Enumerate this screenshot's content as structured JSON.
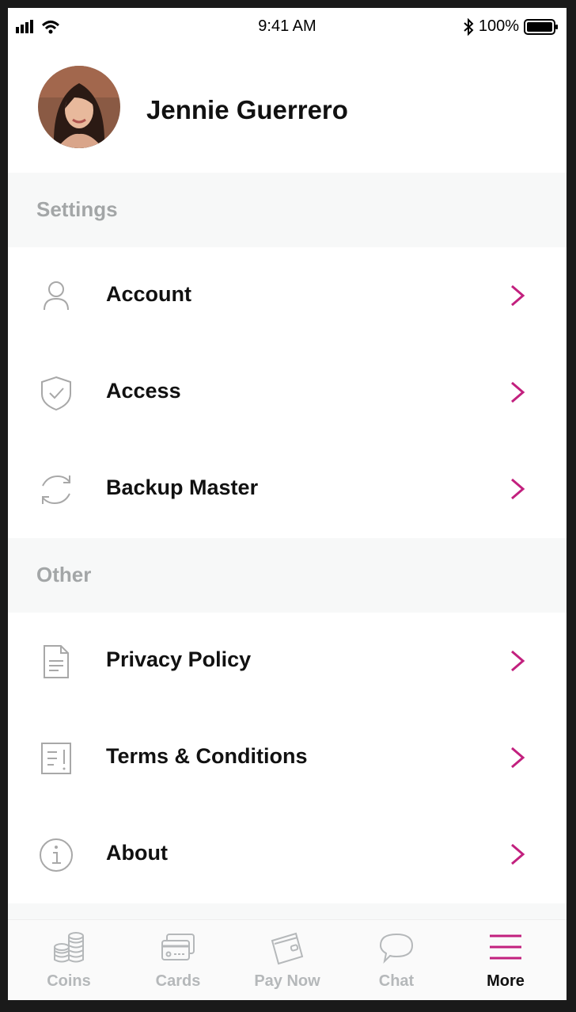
{
  "status_bar": {
    "time": "9:41 AM",
    "battery": "100%"
  },
  "profile": {
    "name": "Jennie Guerrero"
  },
  "sections": {
    "settings": {
      "title": "Settings",
      "items": [
        {
          "label": "Account",
          "icon": "user-icon"
        },
        {
          "label": "Access",
          "icon": "shield-check-icon"
        },
        {
          "label": "Backup Master",
          "icon": "sync-icon"
        }
      ]
    },
    "other": {
      "title": "Other",
      "items": [
        {
          "label": "Privacy Policy",
          "icon": "document-icon"
        },
        {
          "label": "Terms & Conditions",
          "icon": "terms-icon"
        },
        {
          "label": "About",
          "icon": "info-icon"
        }
      ]
    }
  },
  "tabbar": {
    "tabs": [
      {
        "label": "Coins",
        "icon": "coins-icon"
      },
      {
        "label": "Cards",
        "icon": "cards-icon"
      },
      {
        "label": "Pay Now",
        "icon": "wallet-icon"
      },
      {
        "label": "Chat",
        "icon": "chat-icon"
      },
      {
        "label": "More",
        "icon": "menu-icon",
        "active": true
      }
    ]
  },
  "colors": {
    "accent": "#c2207e",
    "section_bg": "#f7f8f8",
    "muted": "#a3a6a7"
  }
}
